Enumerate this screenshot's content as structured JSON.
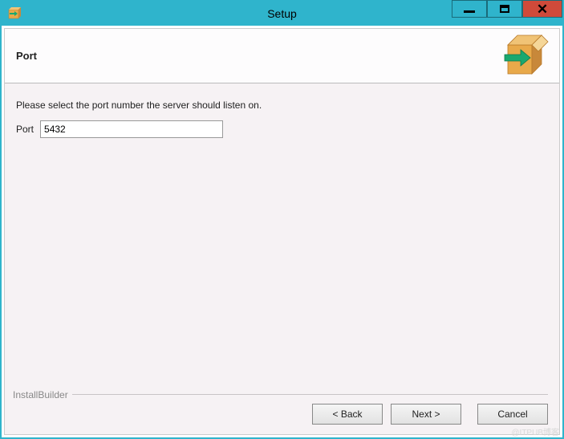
{
  "window": {
    "title": "Setup"
  },
  "header": {
    "title": "Port"
  },
  "content": {
    "instruction": "Please select the port number the server should listen on.",
    "port_label": "Port",
    "port_value": "5432"
  },
  "footer": {
    "branding": "InstallBuilder",
    "back_label": "< Back",
    "next_label": "Next >",
    "cancel_label": "Cancel"
  },
  "watermark": "@ITPUB博客"
}
